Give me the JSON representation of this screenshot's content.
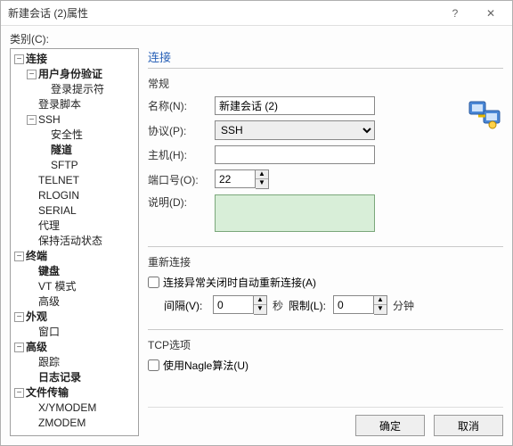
{
  "window": {
    "title": "新建会话 (2)属性"
  },
  "category_label": "类别(C):",
  "tree": {
    "connection": "连接",
    "user_auth": "用户身份验证",
    "login_prompt": "登录提示符",
    "login_script": "登录脚本",
    "ssh": "SSH",
    "security": "安全性",
    "tunnel": "隧道",
    "sftp": "SFTP",
    "telnet": "TELNET",
    "rlogin": "RLOGIN",
    "serial": "SERIAL",
    "proxy": "代理",
    "keepalive": "保持活动状态",
    "terminal": "终端",
    "keyboard": "键盘",
    "vt_mode": "VT 模式",
    "advanced_term": "高级",
    "appearance": "外观",
    "window_item": "窗口",
    "advanced": "高级",
    "trace": "跟踪",
    "logging": "日志记录",
    "file_transfer": "文件传输",
    "xymodem": "X/YMODEM",
    "zmodem": "ZMODEM"
  },
  "panel": {
    "section": "连接",
    "general": {
      "title": "常规",
      "name_label": "名称(N):",
      "name_value": "新建会话 (2)",
      "protocol_label": "协议(P):",
      "protocol_value": "SSH",
      "host_label": "主机(H):",
      "host_value": "",
      "port_label": "端口号(O):",
      "port_value": "22",
      "desc_label": "说明(D):"
    },
    "reconnect": {
      "title": "重新连接",
      "checkbox": "连接异常关闭时自动重新连接(A)",
      "interval_label": "间隔(V):",
      "interval_value": "0",
      "interval_unit": "秒",
      "limit_label": "限制(L):",
      "limit_value": "0",
      "limit_unit": "分钟"
    },
    "tcp": {
      "title": "TCP选项",
      "nagle": "使用Nagle算法(U)"
    }
  },
  "buttons": {
    "ok": "确定",
    "cancel": "取消"
  }
}
